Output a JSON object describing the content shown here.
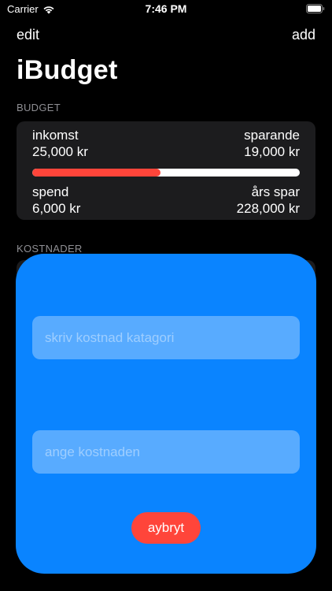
{
  "status_bar": {
    "carrier": "Carrier",
    "time": "7:46 PM",
    "wifi_icon": "wifi-icon",
    "battery_icon": "battery-icon"
  },
  "nav": {
    "left_label": "edit",
    "right_label": "add",
    "title": "iBudget"
  },
  "budget": {
    "section_header": "BUDGET",
    "inkomst_label": "inkomst",
    "inkomst_value": "25,000 kr",
    "sparande_label": "sparande",
    "sparande_value": "19,000 kr",
    "spend_label": "spend",
    "spend_value": "6,000 kr",
    "ars_spar_label": "års spar",
    "ars_spar_value": "228,000 kr",
    "progress_fraction": 0.48
  },
  "kostnader": {
    "section_header": "KOSTNADER"
  },
  "sheet": {
    "kategori_placeholder": "skriv kostnad katagori",
    "kostnad_placeholder": "ange kostnaden",
    "cancel_label": "aybryt"
  },
  "colors": {
    "background": "#000000",
    "card": "#1c1c1e",
    "sheet_blue": "#0a84ff",
    "progress_red": "#ff453a",
    "progress_track": "#ffffff",
    "section_gray": "#8e8e93"
  }
}
